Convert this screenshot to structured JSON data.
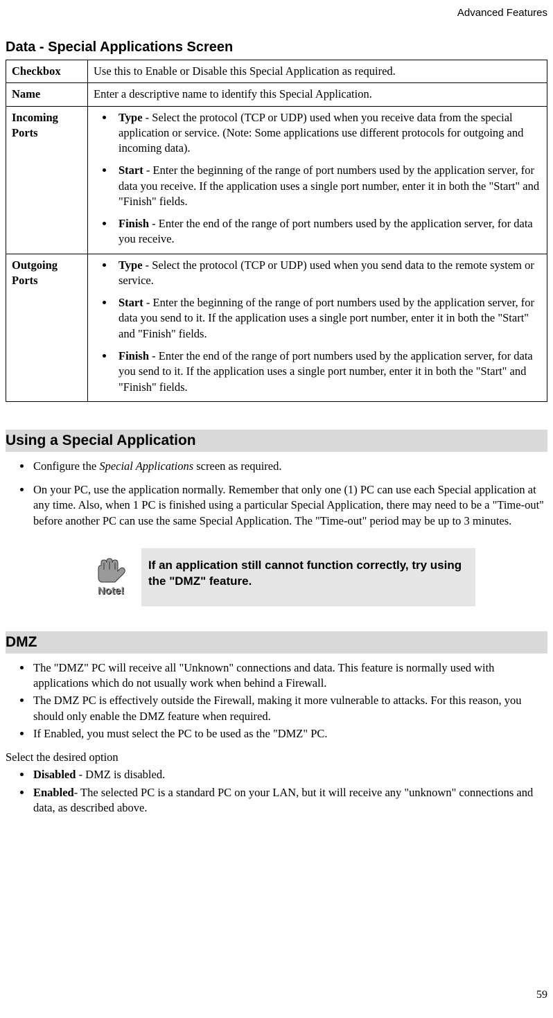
{
  "header": "Advanced Features",
  "section1_title": "Data - Special Applications Screen",
  "table": {
    "rows": [
      {
        "label": "Checkbox",
        "text": "Use this to Enable or Disable this Special Application as required."
      },
      {
        "label": "Name",
        "text": "Enter a descriptive name to identify this Special Application."
      },
      {
        "label": "Incoming Ports",
        "items": [
          {
            "term": "Type",
            "desc": " - Select the protocol (TCP or UDP) used when you receive data from the special application or service. (Note: Some applications use different protocols for outgoing and incoming data)."
          },
          {
            "term": "Start",
            "desc": " - Enter the beginning of the range of port numbers used by the application server, for data you receive. If the application uses a single port number, enter it in both the \"Start\" and \"Finish\" fields."
          },
          {
            "term": "Finish",
            "desc": " - Enter the end of the range of port numbers used by the application server, for data you receive."
          }
        ]
      },
      {
        "label": "Outgoing Ports",
        "items": [
          {
            "term": "Type",
            "desc": " - Select the protocol (TCP or UDP) used when you send data to the remote system or service."
          },
          {
            "term": "Start",
            "desc": " - Enter the beginning of the range of port numbers used by the application server, for data you send to it. If the application uses a single port number, enter it in both the \"Start\" and \"Finish\" fields."
          },
          {
            "term": "Finish",
            "desc": " - Enter the end of the range of port numbers used by the application server, for data you send to it. If the application uses a single port number, enter it in both the \"Start\" and \"Finish\" fields."
          }
        ]
      }
    ]
  },
  "section2": {
    "heading": "Using a Special Application",
    "items": [
      {
        "pre": "Configure the ",
        "italic": "Special Applications",
        "post": " screen as required."
      },
      {
        "text": "On your PC, use the application normally. Remember that only one (1) PC can use each Special application at any time. Also, when 1 PC is finished using a particular Special Application, there may need to be a \"Time-out\" before another PC can use the same Special Application. The \"Time-out\" period may be up to 3 minutes."
      }
    ]
  },
  "note": {
    "label": "Note!",
    "text": "If an application still cannot function correctly, try using the \"DMZ\" feature."
  },
  "section3": {
    "heading": "DMZ",
    "items1": [
      "The \"DMZ\" PC will receive all \"Unknown\" connections and data. This feature is normally used with applications which do not usually work when behind a Firewall.",
      "The DMZ PC is effectively outside the Firewall, making it more vulnerable to attacks. For this reason, you should only enable the DMZ feature when required.",
      "If Enabled, you must select the PC to be used as the \"DMZ\" PC."
    ],
    "select_text": "Select the desired option",
    "items2": [
      {
        "term": "Disabled",
        "desc": " - DMZ is disabled."
      },
      {
        "term": "Enabled",
        "desc": "- The selected PC is a standard PC on your LAN, but it will receive any \"unknown\" connections and data, as described above."
      }
    ]
  },
  "page_number": "59"
}
